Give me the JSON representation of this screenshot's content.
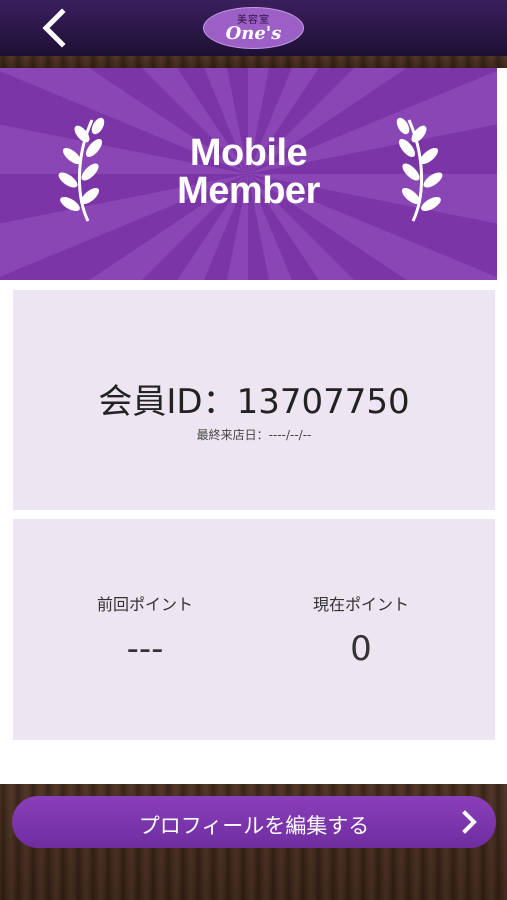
{
  "header": {
    "back_icon": "chevron-left-icon",
    "logo": {
      "top_text": "美容室",
      "main_text": "One's"
    }
  },
  "banner": {
    "title_line1": "Mobile",
    "title_line2": "Member",
    "colors": {
      "base": "#7b35a6",
      "ray": "#8a46b4"
    }
  },
  "member": {
    "id_text": "会員ID：13707750",
    "last_visit": "最終来店日：----/--/--"
  },
  "points": {
    "previous": {
      "label": "前回ポイント",
      "value": "---"
    },
    "current": {
      "label": "現在ポイント",
      "value": "0"
    }
  },
  "actions": {
    "edit_profile_label": "プロフィールを編集する",
    "chevron_icon": "chevron-right-icon"
  },
  "colors": {
    "accent": "#7b35a6",
    "card_bg": "#ede5f1",
    "header_bg": "#2a1745"
  }
}
